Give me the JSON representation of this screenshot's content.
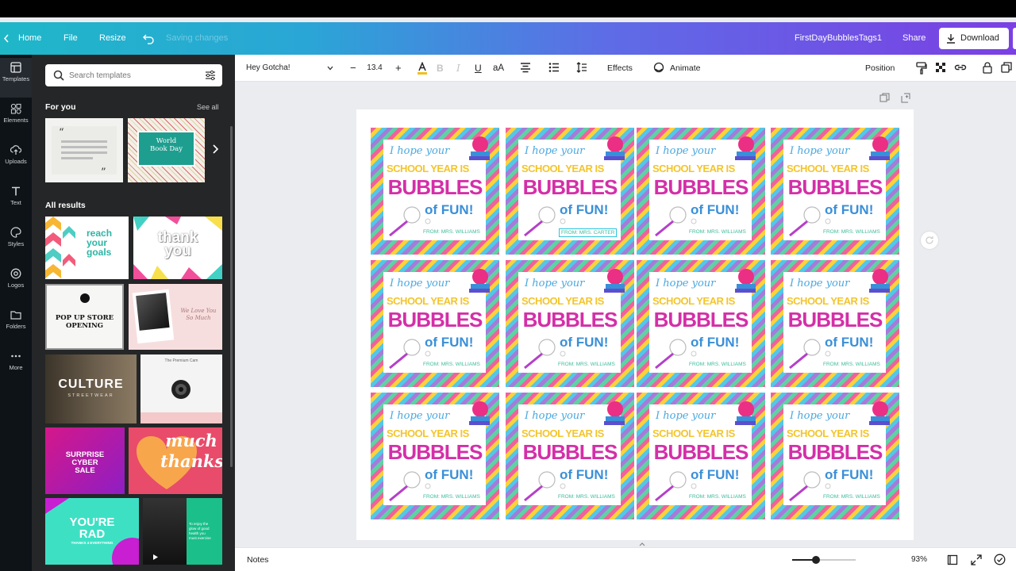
{
  "topbar": {
    "home": "Home",
    "file": "File",
    "resize": "Resize",
    "save_status": "Saving changes",
    "doc_title": "FirstDayBubblesTags1",
    "share": "Share",
    "download": "Download"
  },
  "rail": {
    "items": [
      {
        "label": "Templates",
        "icon": "templates-icon"
      },
      {
        "label": "Elements",
        "icon": "elements-icon"
      },
      {
        "label": "Uploads",
        "icon": "upload-icon"
      },
      {
        "label": "Text",
        "icon": "text-icon"
      },
      {
        "label": "Styles",
        "icon": "palette-icon"
      },
      {
        "label": "Logos",
        "icon": "logo-icon"
      },
      {
        "label": "Folders",
        "icon": "folder-icon"
      },
      {
        "label": "More",
        "icon": "more-icon"
      }
    ]
  },
  "panel": {
    "search_placeholder": "Search templates",
    "for_you": "For you",
    "see_all": "See all",
    "all_results": "All results",
    "foryou_cards": [
      {
        "name": "quote"
      },
      {
        "name": "world-book-day",
        "line1": "World",
        "line2": "Book Day"
      }
    ],
    "templates": [
      {
        "name": "reach-your-goals",
        "lines": [
          "reach",
          "your",
          "goals"
        ]
      },
      {
        "name": "thank-you",
        "lines": [
          "thank",
          "you"
        ]
      },
      {
        "name": "pop-up-store",
        "lines": [
          "POP UP STORE",
          "OPENING"
        ]
      },
      {
        "name": "we-love-you-so-much",
        "lines": [
          "We Love You",
          "So Much"
        ]
      },
      {
        "name": "culture-streetwear",
        "lines": [
          "CULTURE",
          "STREETWEAR"
        ]
      },
      {
        "name": "the-premium-cam",
        "lines": [
          "The Premium Cam"
        ]
      },
      {
        "name": "surprise-cyber-sale",
        "lines": [
          "SURPRISE",
          "CYBER",
          "SALE"
        ]
      },
      {
        "name": "much-thanks",
        "lines": [
          "much",
          "thanks"
        ]
      },
      {
        "name": "youre-rad",
        "lines": [
          "YOU'RE",
          "RAD",
          "THANKS 4 EVERYTHING"
        ]
      },
      {
        "name": "video-enjoy",
        "lines": [
          "To enjoy the",
          "glow of good",
          "health you",
          "must exercise"
        ]
      }
    ]
  },
  "toolbar": {
    "font": "Hey Gotcha!",
    "size": "13.4",
    "effects": "Effects",
    "animate": "Animate",
    "position": "Position"
  },
  "tag": {
    "line1": "I hope your",
    "line2": "SCHOOL YEAR IS",
    "line3": "BUBBLES",
    "line4": "of FUN!",
    "from": "FROM: MRS. WILLIAMS",
    "from_selected": "FROM: MRS. CARTER"
  },
  "bottombar": {
    "notes": "Notes",
    "zoom": "93%",
    "zoom_fraction": 0.38
  },
  "colors": {
    "accent_start": "#1fb7c8",
    "accent_end": "#7b3fe4",
    "bubbles_magenta": "#d42fa8",
    "school_yellow": "#f3c52d",
    "hope_blue": "#4aa8e0",
    "from_green": "#3dbb9c"
  }
}
